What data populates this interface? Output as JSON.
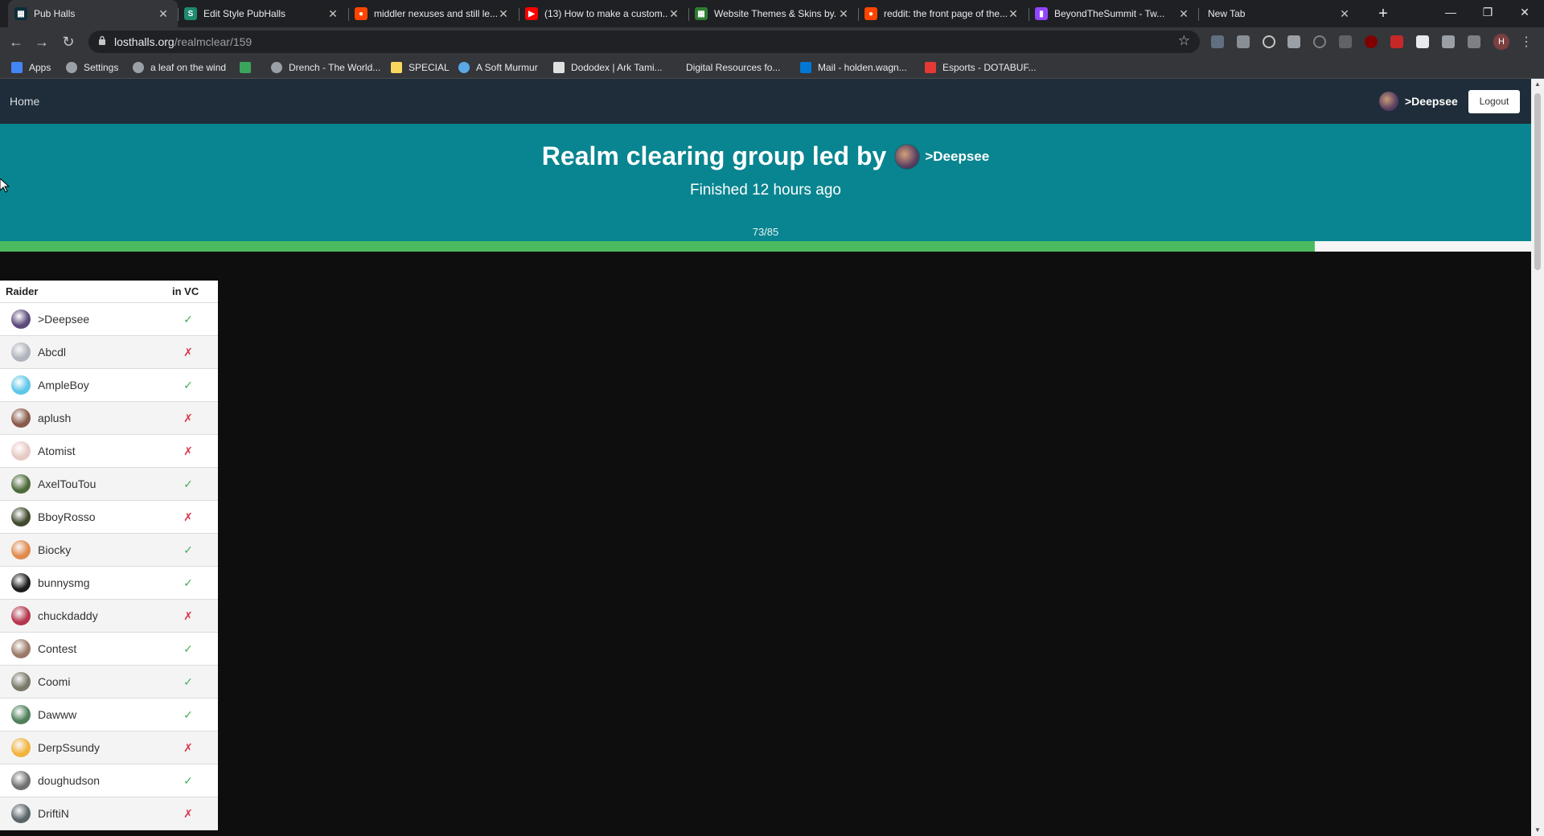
{
  "browser": {
    "tabs": [
      {
        "title": "Pub Halls",
        "icon": "pubhalls-tab-icon",
        "color": "#0b2e3a",
        "glyph": "▦",
        "active": true
      },
      {
        "title": "Edit Style PubHalls",
        "icon": "stylus-tab-icon",
        "color": "#1f8a70",
        "glyph": "S"
      },
      {
        "title": "middler nexuses and still le...",
        "icon": "reddit-tab-icon",
        "color": "#ff4500",
        "glyph": "●"
      },
      {
        "title": "(13) How to make a custom...",
        "icon": "youtube-tab-icon",
        "color": "#ff0000",
        "glyph": "▶"
      },
      {
        "title": "Website Themes & Skins by...",
        "icon": "userstyles-tab-icon",
        "color": "#2e7d32",
        "glyph": "▦"
      },
      {
        "title": "reddit: the front page of the...",
        "icon": "reddit-tab-icon",
        "color": "#ff4500",
        "glyph": "●"
      },
      {
        "title": "BeyondTheSummit - Tw...",
        "icon": "twitch-tab-icon",
        "color": "#9146ff",
        "glyph": "▮"
      },
      {
        "title": "New Tab",
        "icon": "",
        "color": "",
        "glyph": ""
      }
    ],
    "url_host": "losthalls.org",
    "url_path": "/realmclear/159",
    "profile_initial": "H",
    "bookmarks": [
      {
        "label": "Apps",
        "icon": "apps-icon",
        "color": "#4285f4"
      },
      {
        "label": "Settings",
        "icon": "gear-icon",
        "color": "#9aa0a6"
      },
      {
        "label": "a leaf on the wind",
        "icon": "globe-icon",
        "color": "#9aa0a6"
      },
      {
        "label": "",
        "icon": "bookmark-site-icon",
        "color": "#3ba55c"
      },
      {
        "label": "Drench - The World...",
        "icon": "globe-icon",
        "color": "#9aa0a6"
      },
      {
        "label": "SPECIAL",
        "icon": "folder-icon",
        "color": "#f9d65c"
      },
      {
        "label": "A Soft Murmur",
        "icon": "drop-icon",
        "color": "#5aa9e6"
      },
      {
        "label": "Dododex | Ark Tami...",
        "icon": "dododex-icon",
        "color": "#e0e0e0"
      },
      {
        "label": "Digital Resources fo...",
        "icon": "",
        "color": ""
      },
      {
        "label": "Mail - holden.wagn...",
        "icon": "outlook-icon",
        "color": "#0078d4"
      },
      {
        "label": "Esports - DOTABUF...",
        "icon": "dotabuff-icon",
        "color": "#e53935"
      }
    ]
  },
  "site": {
    "nav_home": "Home",
    "user_name": ">Deepsee",
    "logout_label": "Logout"
  },
  "hero": {
    "headline": "Realm clearing group led by",
    "leader": ">Deepsee",
    "status": "Finished 12 hours ago",
    "progress_text": "73/85",
    "progress_current": 73,
    "progress_total": 85
  },
  "table": {
    "col_raider": "Raider",
    "col_vc": "in VC",
    "yes_glyph": "✓",
    "no_glyph": "✗",
    "rows": [
      {
        "name": ">Deepsee",
        "in_vc": true,
        "avatar_color": "#5b4a7a"
      },
      {
        "name": "Abcdl",
        "in_vc": false,
        "avatar_color": "#b0b4bc"
      },
      {
        "name": "AmpleBoy",
        "in_vc": true,
        "avatar_color": "#5ec6e8"
      },
      {
        "name": "aplush",
        "in_vc": false,
        "avatar_color": "#8a5a4a"
      },
      {
        "name": "Atomist",
        "in_vc": false,
        "avatar_color": "#e7c9c4"
      },
      {
        "name": "AxelTouTou",
        "in_vc": true,
        "avatar_color": "#4d6b3a"
      },
      {
        "name": "BboyRosso",
        "in_vc": false,
        "avatar_color": "#3f4a2c"
      },
      {
        "name": "Biocky",
        "in_vc": true,
        "avatar_color": "#e08a4c"
      },
      {
        "name": "bunnysmg",
        "in_vc": true,
        "avatar_color": "#1d1d1d"
      },
      {
        "name": "chuckdaddy",
        "in_vc": false,
        "avatar_color": "#b5374e"
      },
      {
        "name": "Contest",
        "in_vc": true,
        "avatar_color": "#9a7a68"
      },
      {
        "name": "Coomi",
        "in_vc": true,
        "avatar_color": "#7a7868"
      },
      {
        "name": "Dawww",
        "in_vc": true,
        "avatar_color": "#4f7f5a"
      },
      {
        "name": "DerpSsundy",
        "in_vc": false,
        "avatar_color": "#f2b43c"
      },
      {
        "name": "doughudson",
        "in_vc": true,
        "avatar_color": "#707070"
      },
      {
        "name": "DriftiN",
        "in_vc": false,
        "avatar_color": "#5a6468"
      }
    ]
  }
}
